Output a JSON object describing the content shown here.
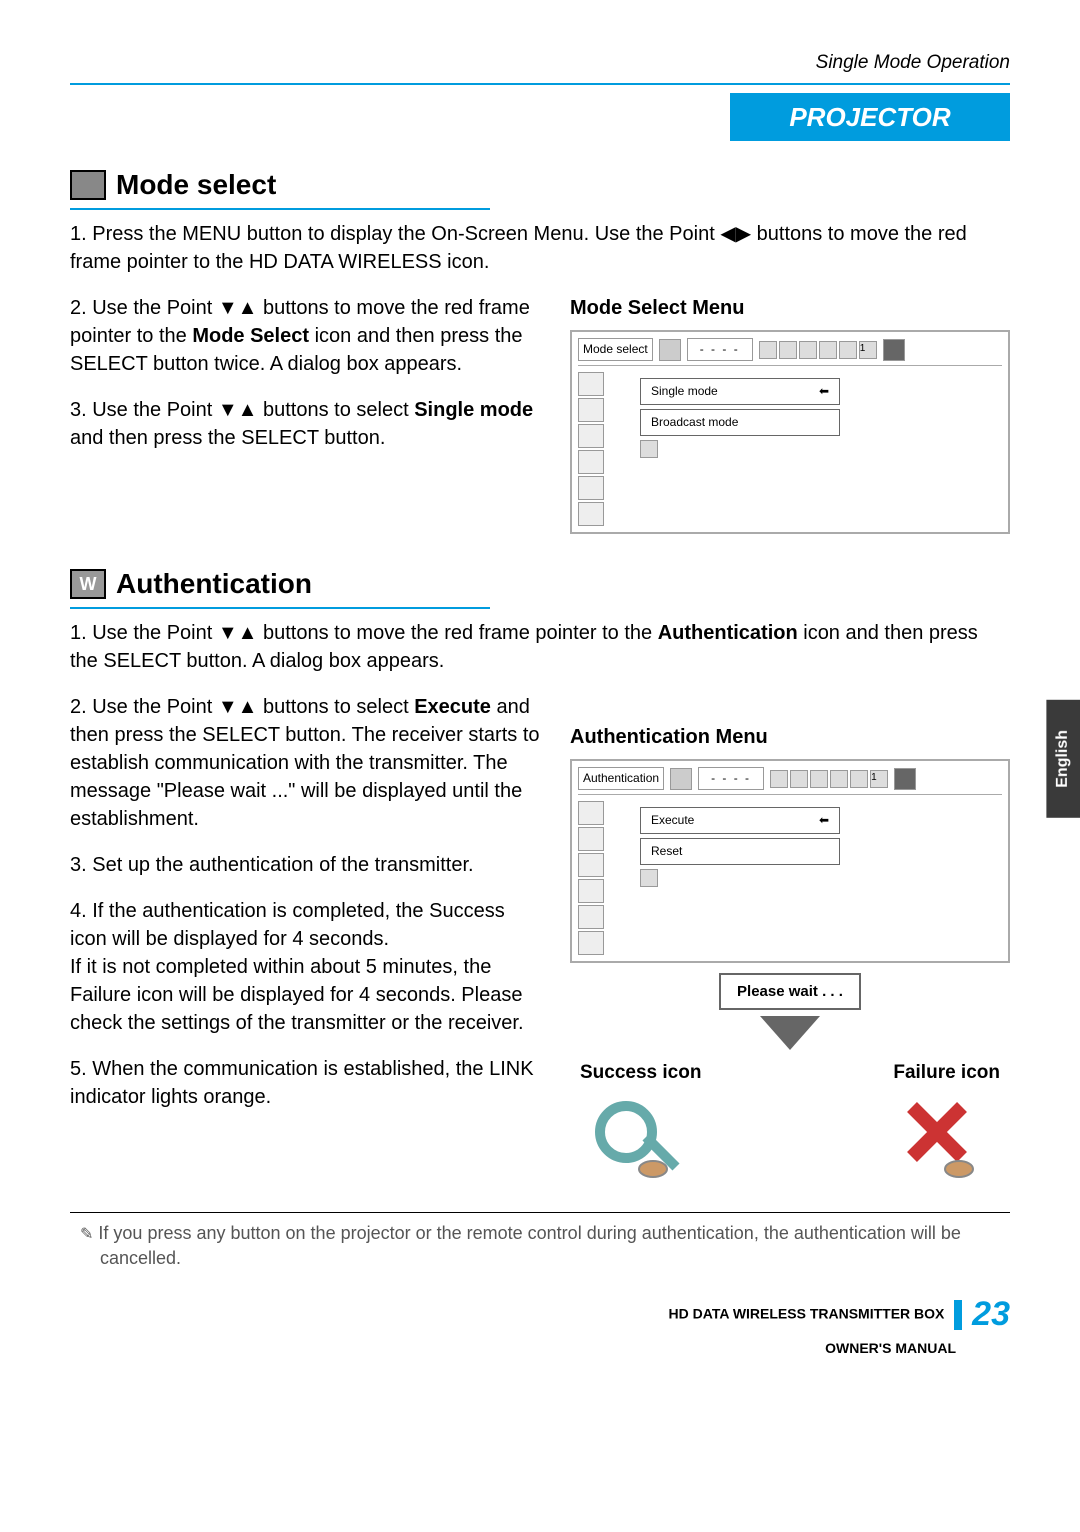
{
  "header": {
    "topRight": "Single Mode Operation",
    "banner": "PROJECTOR"
  },
  "section1": {
    "title": "Mode select",
    "step1": "1. Press the MENU button to display the On-Screen Menu. Use the Point ◀▶ buttons to move the red frame pointer to the HD DATA WIRELESS icon.",
    "step2_a": "2. Use the Point ▼▲ buttons to move the red frame pointer to the ",
    "step2_bold": "Mode Select",
    "step2_b": " icon and then press the SELECT button twice. A dialog box appears.",
    "step3_a": "3.  Use the Point ▼▲ buttons to select ",
    "step3_bold": "Single mode",
    "step3_b": " and then press the SELECT button.",
    "menuTitle": "Mode Select Menu",
    "menuLabel": "Mode select",
    "menuDashes": "- - - -",
    "menuNum": "1",
    "option1": "Single mode",
    "option2": "Broadcast mode"
  },
  "section2": {
    "title": "Authentication",
    "iconText": "W",
    "step1_a": "1. Use the Point ▼▲ buttons to move the red frame pointer to the ",
    "step1_bold": "Authentication",
    "step1_b": " icon and then press the SELECT button. A dialog box appears.",
    "step2_a": "2. Use the Point ▼▲ buttons to select ",
    "step2_bold": "Execute",
    "step2_b": " and then press the SELECT button. The receiver starts to establish communication with the transmitter. The message \"Please wait ...\" will be displayed until the establishment.",
    "step3": "3. Set up the authentication of the transmitter.",
    "step4": "4. If the authentication is completed, the Success icon will be displayed for 4 seconds.\n    If it is not completed within about 5 minutes, the Failure icon will be displayed for 4 seconds. Please check the settings of the transmitter or the receiver.",
    "step5": "5. When the communication is established, the LINK indicator lights orange.",
    "menuTitle": "Authentication Menu",
    "menuLabel": "Authentication",
    "menuDashes": "- - - -",
    "menuNum": "1",
    "option1": "Execute",
    "option2": "Reset",
    "pleaseWait": "Please wait . . .",
    "successLabel": "Success icon",
    "failureLabel": "Failure icon"
  },
  "footnote": {
    "icon": "✎",
    "text": "If you press any button on the projector or the remote control during authentication, the authentication will be cancelled."
  },
  "footer": {
    "line1": "HD DATA WIRELESS TRANSMITTER BOX",
    "line2": "OWNER'S MANUAL",
    "page": "23"
  },
  "sideTab": "English"
}
